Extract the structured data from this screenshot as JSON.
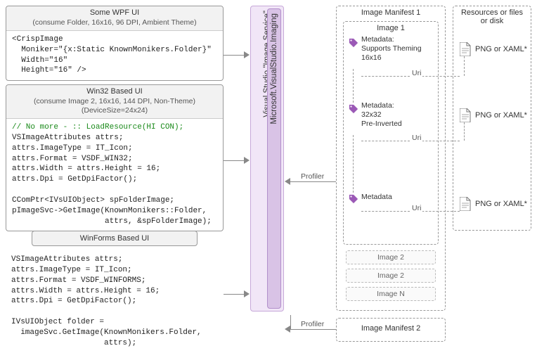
{
  "left": {
    "wpf": {
      "title": "Some WPF UI",
      "sub": "(consume Folder, 16x16, 96 DPI, Ambient Theme)",
      "code": "<CrispImage\n  Moniker=\"{x:Static KnownMonikers.Folder}\"\n  Width=\"16\"\n  Height=\"16\" />"
    },
    "win32": {
      "title": "Win32 Based UI",
      "sub": "(consume Image 2, 16x16, 144 DPI, Non-Theme)",
      "sub2": "(DeviceSize=24x24)",
      "comment": "// No more - :: LoadResource(HI CON);",
      "code": "VSImageAttributes attrs;\nattrs.ImageType = IT_Icon;\nattrs.Format = VSDF_WIN32;\nattrs.Width = attrs.Height = 16;\nattrs.Dpi = GetDpiFactor();\n\nCComPtr<IVsUIObject> spFolderImage;\npImageSvc->GetImage(KnownMonikers::Folder,\n                    attrs, &spFolderImage);"
    },
    "winforms": {
      "title": "WinForms Based UI",
      "code": "VSImageAttributes attrs;\nattrs.ImageType = IT_Icon;\nattrs.Format = VSDF_WINFORMS;\nattrs.Width = attrs.Height = 16;\nattrs.Dpi = GetDpiFactor();\n\nIVsUIObject folder =\n  imageSvc.GetImage(KnownMonikers.Folder,\n                    attrs);"
    }
  },
  "service": {
    "outer": "Visual Studio \"Image Service\"",
    "inner": "Microsoft.VisualStudio.Imaging"
  },
  "profiler": "Profiler",
  "manifest1": {
    "title": "Image Manifest 1",
    "image1": "Image 1",
    "meta1": "Metadata:\nSupports Theming\n16x16",
    "meta2": "Metadata:\n32x32\nPre-Inverted",
    "meta3": "Metadata",
    "uri": "Uri",
    "slots": {
      "a": "Image 2",
      "b": "Image 2",
      "c": "Image N"
    }
  },
  "manifest2": {
    "title": "Image Manifest 2"
  },
  "resources": {
    "title": "Resources or files\nor disk",
    "file": "PNG or XAML*"
  }
}
